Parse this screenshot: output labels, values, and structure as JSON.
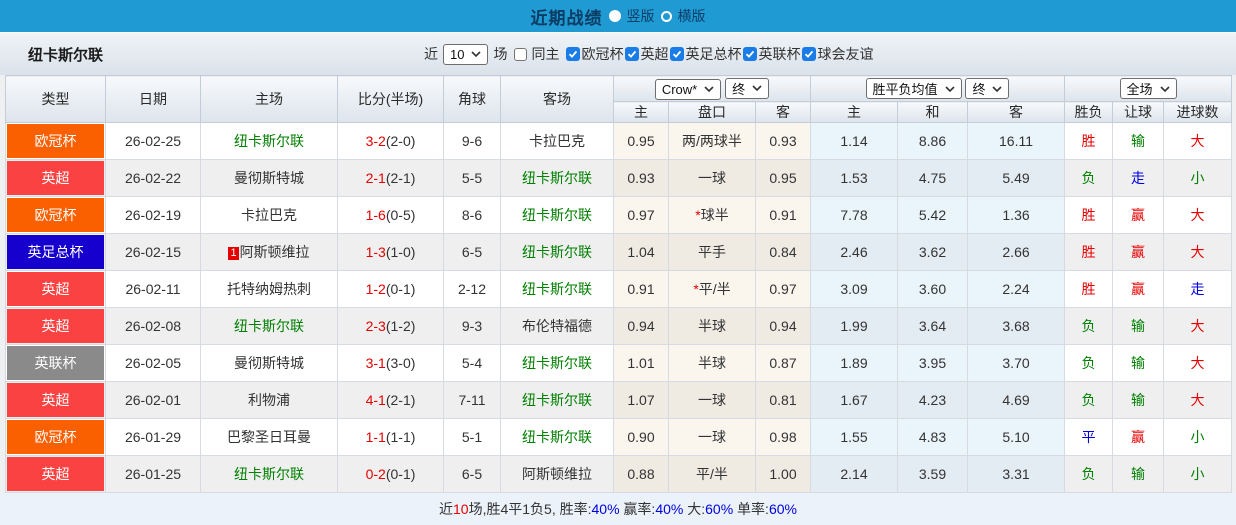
{
  "palette": {
    "topbar": "#1f9ad3",
    "badge_orange": "#fa5f00",
    "badge_red": "#fb4242",
    "badge_blue": "#1500cd",
    "badge_gray": "#8a8a8a",
    "team_green": "#008000",
    "result_red": "#e60000",
    "result_green": "#008000",
    "result_blue": "#0000e0"
  },
  "titlebar": {
    "title": "近期战绩",
    "radios": [
      {
        "label": "竖版",
        "selected": true
      },
      {
        "label": "横版",
        "selected": false
      }
    ]
  },
  "filter": {
    "team_name": "纽卡斯尔联",
    "recent_label": "近",
    "matches_value": "10",
    "matches_label": "场",
    "same_home_label": "同主",
    "same_home_checked": false,
    "competitions": [
      {
        "label": "欧冠杯",
        "checked": true
      },
      {
        "label": "英超",
        "checked": true
      },
      {
        "label": "英足总杯",
        "checked": true
      },
      {
        "label": "英联杯",
        "checked": true
      },
      {
        "label": "球会友谊",
        "checked": true
      }
    ]
  },
  "table": {
    "dropdowns": {
      "bookmaker": "Crow*",
      "bookmaker_state": "终",
      "avg": "胜平负均值",
      "avg_state": "终",
      "period": "全场"
    },
    "headers": {
      "type": "类型",
      "date": "日期",
      "home": "主场",
      "score": "比分(半场)",
      "corner": "角球",
      "away": "客场",
      "odds_home": "主",
      "odds_handicap": "盘口",
      "odds_away": "客",
      "avg_home": "主",
      "avg_draw": "和",
      "avg_away": "客",
      "winloss": "胜负",
      "handicap": "让球",
      "goals": "进球数"
    },
    "rows": [
      {
        "type": "欧冠杯",
        "type_color": "orange",
        "date": "26-02-25",
        "home": "纽卡斯尔联",
        "home_green": true,
        "home_badge": "",
        "score_ft": "3-2",
        "score_ht": "(2-0)",
        "corner": "9-6",
        "away": "卡拉巴克",
        "away_green": false,
        "odds_home": "0.95",
        "handicap": "两/两球半",
        "handicap_star": false,
        "odds_away": "0.93",
        "avg_home": "1.14",
        "avg_draw": "8.86",
        "avg_away": "16.11",
        "wl": "胜",
        "wl_color": "red",
        "hc": "输",
        "hc_color": "green",
        "goals": "大",
        "goals_color": "red"
      },
      {
        "type": "英超",
        "type_color": "red",
        "date": "26-02-22",
        "home": "曼彻斯特城",
        "home_green": false,
        "home_badge": "",
        "score_ft": "2-1",
        "score_ht": "(2-1)",
        "corner": "5-5",
        "away": "纽卡斯尔联",
        "away_green": true,
        "odds_home": "0.93",
        "handicap": "一球",
        "handicap_star": false,
        "odds_away": "0.95",
        "avg_home": "1.53",
        "avg_draw": "4.75",
        "avg_away": "5.49",
        "wl": "负",
        "wl_color": "green",
        "hc": "走",
        "hc_color": "blue",
        "goals": "小",
        "goals_color": "green"
      },
      {
        "type": "欧冠杯",
        "type_color": "orange",
        "date": "26-02-19",
        "home": "卡拉巴克",
        "home_green": false,
        "home_badge": "",
        "score_ft": "1-6",
        "score_ht": "(0-5)",
        "corner": "8-6",
        "away": "纽卡斯尔联",
        "away_green": true,
        "odds_home": "0.97",
        "handicap": "球半",
        "handicap_star": true,
        "odds_away": "0.91",
        "avg_home": "7.78",
        "avg_draw": "5.42",
        "avg_away": "1.36",
        "wl": "胜",
        "wl_color": "red",
        "hc": "赢",
        "hc_color": "red",
        "goals": "大",
        "goals_color": "red"
      },
      {
        "type": "英足总杯",
        "type_color": "blue",
        "date": "26-02-15",
        "home": "阿斯顿维拉",
        "home_green": false,
        "home_badge": "1",
        "score_ft": "1-3",
        "score_ht": "(1-0)",
        "corner": "6-5",
        "away": "纽卡斯尔联",
        "away_green": true,
        "odds_home": "1.04",
        "handicap": "平手",
        "handicap_star": false,
        "odds_away": "0.84",
        "avg_home": "2.46",
        "avg_draw": "3.62",
        "avg_away": "2.66",
        "wl": "胜",
        "wl_color": "red",
        "hc": "赢",
        "hc_color": "red",
        "goals": "大",
        "goals_color": "red"
      },
      {
        "type": "英超",
        "type_color": "red",
        "date": "26-02-11",
        "home": "托特纳姆热刺",
        "home_green": false,
        "home_badge": "",
        "score_ft": "1-2",
        "score_ht": "(0-1)",
        "corner": "2-12",
        "away": "纽卡斯尔联",
        "away_green": true,
        "odds_home": "0.91",
        "handicap": "平/半",
        "handicap_star": true,
        "odds_away": "0.97",
        "avg_home": "3.09",
        "avg_draw": "3.60",
        "avg_away": "2.24",
        "wl": "胜",
        "wl_color": "red",
        "hc": "赢",
        "hc_color": "red",
        "goals": "走",
        "goals_color": "blue"
      },
      {
        "type": "英超",
        "type_color": "red",
        "date": "26-02-08",
        "home": "纽卡斯尔联",
        "home_green": true,
        "home_badge": "",
        "score_ft": "2-3",
        "score_ht": "(1-2)",
        "corner": "9-3",
        "away": "布伦特福德",
        "away_green": false,
        "odds_home": "0.94",
        "handicap": "半球",
        "handicap_star": false,
        "odds_away": "0.94",
        "avg_home": "1.99",
        "avg_draw": "3.64",
        "avg_away": "3.68",
        "wl": "负",
        "wl_color": "green",
        "hc": "输",
        "hc_color": "green",
        "goals": "大",
        "goals_color": "red"
      },
      {
        "type": "英联杯",
        "type_color": "gray",
        "date": "26-02-05",
        "home": "曼彻斯特城",
        "home_green": false,
        "home_badge": "",
        "score_ft": "3-1",
        "score_ht": "(3-0)",
        "corner": "5-4",
        "away": "纽卡斯尔联",
        "away_green": true,
        "odds_home": "1.01",
        "handicap": "半球",
        "handicap_star": false,
        "odds_away": "0.87",
        "avg_home": "1.89",
        "avg_draw": "3.95",
        "avg_away": "3.70",
        "wl": "负",
        "wl_color": "green",
        "hc": "输",
        "hc_color": "green",
        "goals": "大",
        "goals_color": "red"
      },
      {
        "type": "英超",
        "type_color": "red",
        "date": "26-02-01",
        "home": "利物浦",
        "home_green": false,
        "home_badge": "",
        "score_ft": "4-1",
        "score_ht": "(2-1)",
        "corner": "7-11",
        "away": "纽卡斯尔联",
        "away_green": true,
        "odds_home": "1.07",
        "handicap": "一球",
        "handicap_star": false,
        "odds_away": "0.81",
        "avg_home": "1.67",
        "avg_draw": "4.23",
        "avg_away": "4.69",
        "wl": "负",
        "wl_color": "green",
        "hc": "输",
        "hc_color": "green",
        "goals": "大",
        "goals_color": "red"
      },
      {
        "type": "欧冠杯",
        "type_color": "orange",
        "date": "26-01-29",
        "home": "巴黎圣日耳曼",
        "home_green": false,
        "home_badge": "",
        "score_ft": "1-1",
        "score_ht": "(1-1)",
        "corner": "5-1",
        "away": "纽卡斯尔联",
        "away_green": true,
        "odds_home": "0.90",
        "handicap": "一球",
        "handicap_star": false,
        "odds_away": "0.98",
        "avg_home": "1.55",
        "avg_draw": "4.83",
        "avg_away": "5.10",
        "wl": "平",
        "wl_color": "blue",
        "hc": "赢",
        "hc_color": "red",
        "goals": "小",
        "goals_color": "green"
      },
      {
        "type": "英超",
        "type_color": "red",
        "date": "26-01-25",
        "home": "纽卡斯尔联",
        "home_green": true,
        "home_badge": "",
        "score_ft": "0-2",
        "score_ht": "(0-1)",
        "corner": "6-5",
        "away": "阿斯顿维拉",
        "away_green": false,
        "odds_home": "0.88",
        "handicap": "平/半",
        "handicap_star": false,
        "odds_away": "1.00",
        "avg_home": "2.14",
        "avg_draw": "3.59",
        "avg_away": "3.31",
        "wl": "负",
        "wl_color": "green",
        "hc": "输",
        "hc_color": "green",
        "goals": "小",
        "goals_color": "green"
      }
    ]
  },
  "footer": {
    "parts": [
      {
        "text": "近",
        "color": "black"
      },
      {
        "text": "10",
        "color": "red"
      },
      {
        "text": "场,胜4平1负5, 胜率:",
        "color": "black"
      },
      {
        "text": "40%",
        "color": "blue"
      },
      {
        "text": " 赢率:",
        "color": "black"
      },
      {
        "text": "40%",
        "color": "blue"
      },
      {
        "text": " 大:",
        "color": "black"
      },
      {
        "text": "60%",
        "color": "blue"
      },
      {
        "text": " 单率:",
        "color": "black"
      },
      {
        "text": "60%",
        "color": "blue"
      }
    ]
  }
}
